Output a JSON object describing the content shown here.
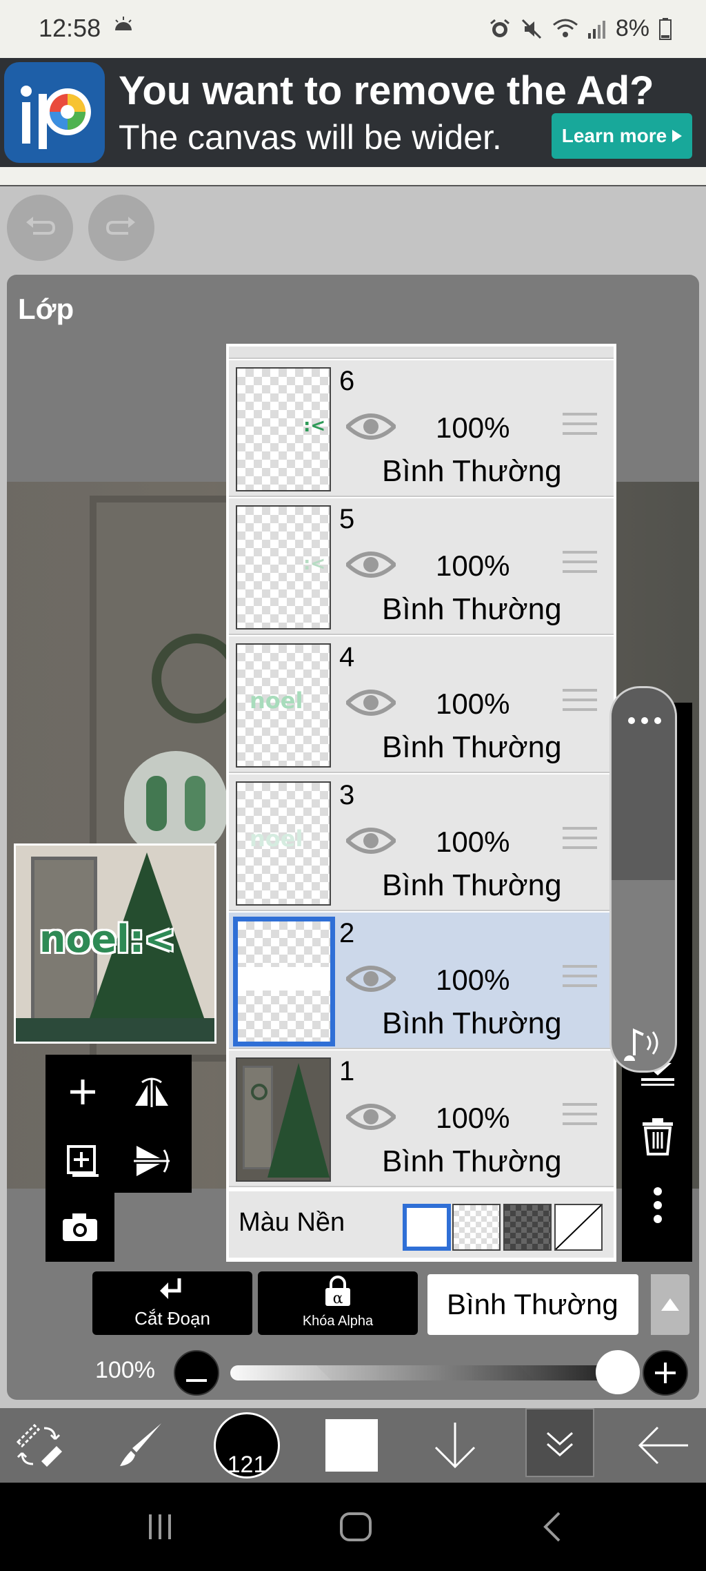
{
  "status": {
    "time": "12:58",
    "battery": "8%",
    "icons": [
      "sun-icon",
      "alarm-icon",
      "mute-icon",
      "wifi-icon",
      "signal-icon",
      "battery-icon"
    ]
  },
  "ad": {
    "title": "You want to remove the Ad?",
    "subtitle": "The canvas will be wider.",
    "button": "Learn more"
  },
  "panel": {
    "title": "Lớp"
  },
  "layers": [
    {
      "number": "6",
      "opacity": "100%",
      "blend": "Bình Thường",
      "thumb_mark": ":<"
    },
    {
      "number": "5",
      "opacity": "100%",
      "blend": "Bình Thường",
      "thumb_mark": ":<"
    },
    {
      "number": "4",
      "opacity": "100%",
      "blend": "Bình Thường",
      "thumb_mark": "noel"
    },
    {
      "number": "3",
      "opacity": "100%",
      "blend": "Bình Thường",
      "thumb_mark": "noel"
    },
    {
      "number": "2",
      "opacity": "100%",
      "blend": "Bình Thường",
      "selected": true
    },
    {
      "number": "1",
      "opacity": "100%",
      "blend": "Bình Thường"
    }
  ],
  "background_color": {
    "label": "Màu Nền"
  },
  "controls": {
    "clip_label": "Cắt Đoạn",
    "alpha_lock_label": "Khóa Alpha",
    "alpha_symbol": "α",
    "blend_mode": "Bình Thường",
    "opacity_label": "100%",
    "opacity_value": 1.0
  },
  "toolbar": {
    "brush_size": "121"
  },
  "preview": {
    "text": "noel:<"
  },
  "colors": {
    "accent": "#2f6fd6",
    "ad_button": "#18a89a",
    "selected_row": "#ccd8ea"
  }
}
